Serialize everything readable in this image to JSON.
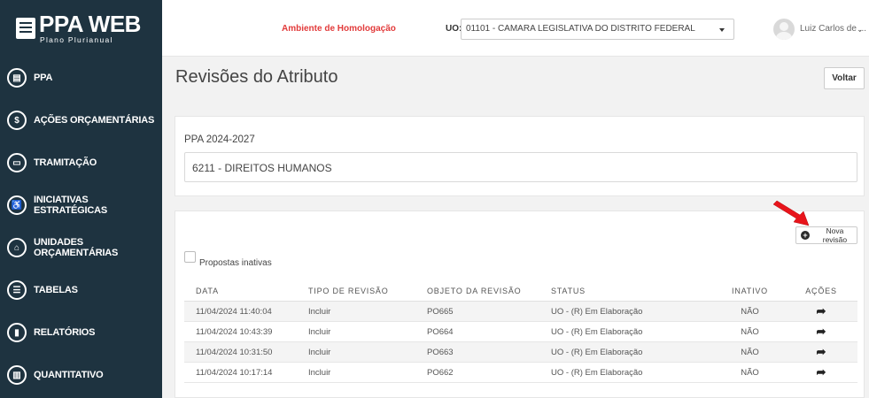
{
  "app": {
    "title": "PPA WEB",
    "subtitle": "Plano Plurianual"
  },
  "sidebar": {
    "items": [
      {
        "label": "PPA",
        "icon": "book-icon",
        "glyph": "▤"
      },
      {
        "label": "AÇÕES ORÇAMENTÁRIAS",
        "icon": "dollar-icon",
        "glyph": "$"
      },
      {
        "label": "TRAMITAÇÃO",
        "icon": "inbox-icon",
        "glyph": "▭"
      },
      {
        "label": "INICIATIVAS ESTRATÉGICAS",
        "icon": "accessibility-icon",
        "glyph": "♿"
      },
      {
        "label": "UNIDADES ORÇAMENTÁRIAS",
        "icon": "institution-icon",
        "glyph": "⌂"
      },
      {
        "label": "TABELAS",
        "icon": "list-icon",
        "glyph": "☰"
      },
      {
        "label": "RELATÓRIOS",
        "icon": "file-icon",
        "glyph": "▮"
      },
      {
        "label": "QUANTITATIVO",
        "icon": "chart-icon",
        "glyph": "▥"
      }
    ]
  },
  "topbar": {
    "environment": "Ambiente de Homologação",
    "uo_label": "UO:",
    "uo_value": "01101 - CAMARA LEGISLATIVA DO DISTRITO FEDERAL",
    "user_name": "Luiz Carlos de ...",
    "user_caret": "⌄"
  },
  "page": {
    "title": "Revisões do Atributo",
    "back_label": "Voltar"
  },
  "info": {
    "ppa": "PPA 2024-2027",
    "program": "6211 - DIREITOS HUMANOS"
  },
  "revisions": {
    "new_label": "Nova revisão",
    "inactive_label": "Propostas inativas",
    "inactive_checked": false,
    "columns": [
      "DATA",
      "TIPO DE REVISÃO",
      "OBJETO DA REVISÃO",
      "STATUS",
      "INATIVO",
      "AÇÕES"
    ],
    "rows": [
      {
        "data": "11/04/2024 11:40:04",
        "tipo": "Incluir",
        "objeto": "PO665",
        "status": "UO - (R) Em Elaboração",
        "inativo": "NÃO"
      },
      {
        "data": "11/04/2024 10:43:39",
        "tipo": "Incluir",
        "objeto": "PO664",
        "status": "UO - (R) Em Elaboração",
        "inativo": "NÃO"
      },
      {
        "data": "11/04/2024 10:31:50",
        "tipo": "Incluir",
        "objeto": "PO663",
        "status": "UO - (R) Em Elaboração",
        "inativo": "NÃO"
      },
      {
        "data": "11/04/2024 10:17:14",
        "tipo": "Incluir",
        "objeto": "PO662",
        "status": "UO - (R) Em Elaboração",
        "inativo": "NÃO"
      }
    ]
  },
  "colors": {
    "sidebar_bg": "#1e3340",
    "environment_text": "#e23b3b",
    "annotation_arrow": "#e8141b"
  }
}
